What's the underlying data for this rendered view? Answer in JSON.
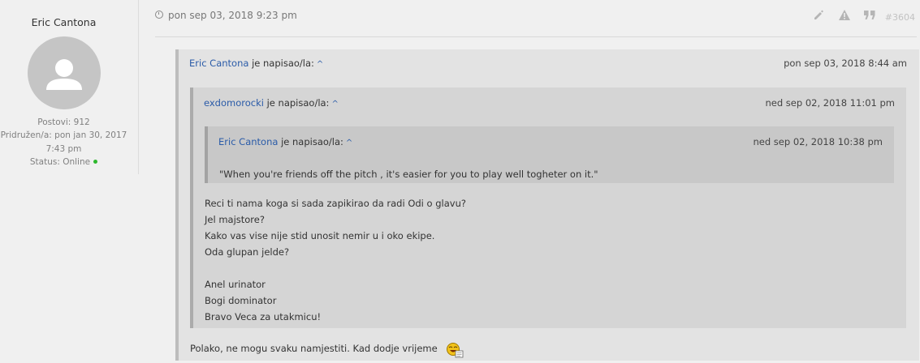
{
  "profile": {
    "username": "Eric Cantona",
    "posts": "Postovi: 912",
    "joined_line1": "Pridružen/a: pon jan 30, 2017",
    "joined_line2": "7:43 pm",
    "status_label": "Status: Online",
    "status_color": "#2db82d"
  },
  "post": {
    "date": "pon sep 03, 2018 9:23 pm",
    "number": "#3604",
    "actions": [
      "pencil-icon",
      "warning-icon",
      "quote-icon"
    ],
    "reply_text": "Polako, ne mogu svaku namjestiti. Kad dodje vrijeme"
  },
  "quote1": {
    "author": "Eric Cantona",
    "wrote": "je napisao/la:",
    "up": "^",
    "date": "pon sep 03, 2018 8:44 am"
  },
  "quote2": {
    "author": "exdomorocki",
    "wrote": "je napisao/la:",
    "up": "^",
    "date": "ned sep 02, 2018 11:01 pm",
    "body": "Reci ti nama koga si sada zapikirao da radi Odi o glavu?\nJel majstore?\nKako vas vise nije stid unosit nemir u i oko ekipe.\nOda glupan jelde?\n\nAnel urinator\nBogi dominator\nBravo Veca za utakmicu!"
  },
  "quote3": {
    "author": "Eric Cantona",
    "wrote": "je napisao/la:",
    "up": "^",
    "date": "ned sep 02, 2018 10:38 pm",
    "body": "\"When you're friends off the pitch , it's easier for you to play well togheter on it.\""
  },
  "colors": {
    "link": "#2a5ba8",
    "online": "#2db82d"
  }
}
